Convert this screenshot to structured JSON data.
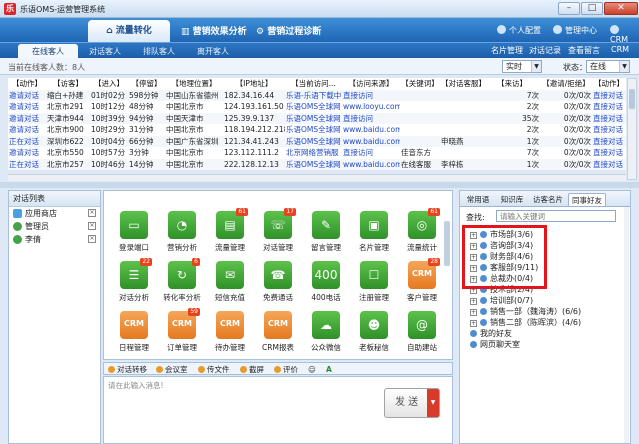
{
  "window": {
    "title": "乐语OMS-运营管理系统",
    "min": "–",
    "max": "□",
    "close": "✕"
  },
  "header": {
    "nav": [
      {
        "label": "流量转化"
      },
      {
        "label": "营销效果分析"
      },
      {
        "label": "营销过程诊断"
      }
    ],
    "links": [
      "个人配置",
      "管理中心",
      "CRM"
    ]
  },
  "tabs": [
    {
      "label": "在线客人"
    },
    {
      "label": "对话客人"
    },
    {
      "label": "排队客人"
    },
    {
      "label": "离开客人"
    }
  ],
  "right_links": [
    "名片管理",
    "对话记录",
    "查看留言",
    "CRM"
  ],
  "filter": {
    "label": "当前在线客人数：8人",
    "select1": "实时",
    "status_label": "状态：",
    "status_value": "在线"
  },
  "table": {
    "headers": [
      "【动作】",
      "【访客】",
      "【进入】",
      "【停留】",
      "【地理位置】",
      "【IP地址】",
      "【当前访问...",
      "【访问来源】",
      "【关键词】",
      "【对话客服】",
      "【来访】",
      "【邀请/拒绝】",
      "【动作】"
    ],
    "rows": [
      [
        "邀请对话",
        "缩白+孙建",
        "01时02分",
        "598分钟",
        "中国山东省德州",
        "182.34.16.44",
        "乐语-乐语下载中",
        "直接访问",
        "",
        "",
        "7次",
        "0次/0次",
        "直接对话"
      ],
      [
        "邀请对话",
        "北京市291",
        "10时12分",
        "48分钟",
        "中国北京市",
        "124.193.161.50",
        "乐语OMS全球网",
        "www.looyu.com",
        "",
        "",
        "2次",
        "0次/0次",
        "直接对话"
      ],
      [
        "邀请对话",
        "天津市944",
        "10时39分",
        "94分钟",
        "中国天津市",
        "125.39.9.137",
        "乐语OMS全球网",
        "直接访问",
        "",
        "",
        "35次",
        "0次/0次",
        "直接对话"
      ],
      [
        "邀请对话",
        "北京市900",
        "10时29分",
        "31分钟",
        "中国北京市",
        "118.194.212.218",
        "乐语OMS全球网",
        "www.baidu.com",
        "",
        "",
        "2次",
        "0次/0次",
        "直接对话"
      ],
      [
        "正在对话",
        "深圳市622",
        "10时04分",
        "66分钟",
        "中国广东省深圳",
        "121.34.41.243",
        "乐语OMS全球网",
        "www.baidu.com",
        "",
        "申晓燕",
        "1次",
        "0次/0次",
        "直接对话"
      ],
      [
        "邀请对话",
        "北京市550",
        "10时57分",
        "3分钟",
        "中国北京市",
        "123.112.111.2",
        "北京网络营销服",
        "直接访问",
        "佳音东方",
        "",
        "7次",
        "0次/0次",
        "直接对话"
      ],
      [
        "正在对话",
        "北京市257",
        "10时46分",
        "14分钟",
        "中国北京市",
        "222.128.12.13",
        "乐语OMS全球网",
        "www.baidu.com",
        "在线客服",
        "李梓栋",
        "1次",
        "0次/0次",
        "直接对话"
      ]
    ]
  },
  "left_panel": {
    "title": "对话列表",
    "items": [
      "应用商店",
      "管理员",
      "李倩"
    ]
  },
  "apps": [
    {
      "label": "登录端口",
      "glyph": "▭",
      "badge": ""
    },
    {
      "label": "营销分析",
      "glyph": "◔",
      "badge": ""
    },
    {
      "label": "流量管理",
      "glyph": "▤",
      "badge": "61"
    },
    {
      "label": "对话管理",
      "glyph": "☏",
      "badge": "17"
    },
    {
      "label": "留言管理",
      "glyph": "✎",
      "badge": ""
    },
    {
      "label": "名片管理",
      "glyph": "▣",
      "badge": ""
    },
    {
      "label": "流量统计",
      "glyph": "◎",
      "badge": "61"
    },
    {
      "label": "对话分析",
      "glyph": "☰",
      "badge": "22"
    },
    {
      "label": "转化率分析",
      "glyph": "↻",
      "badge": "6"
    },
    {
      "label": "短信充值",
      "glyph": "✉",
      "badge": ""
    },
    {
      "label": "免费通话",
      "glyph": "☎",
      "badge": ""
    },
    {
      "label": "400电话",
      "glyph": "400",
      "badge": ""
    },
    {
      "label": "注册管理",
      "glyph": "☐",
      "badge": ""
    },
    {
      "label": "客户管理",
      "glyph": "CRM",
      "badge": "28"
    },
    {
      "label": "日程管理",
      "glyph": "CRM",
      "badge": ""
    },
    {
      "label": "订单管理",
      "glyph": "CRM",
      "badge": "59"
    },
    {
      "label": "待办管理",
      "glyph": "CRM",
      "badge": ""
    },
    {
      "label": "CRM报表",
      "glyph": "CRM",
      "badge": ""
    },
    {
      "label": "公众微信",
      "glyph": "☁",
      "badge": ""
    },
    {
      "label": "老板秘信",
      "glyph": "☻",
      "badge": ""
    },
    {
      "label": "自助建站",
      "glyph": "@",
      "badge": ""
    }
  ],
  "chat_toolbar": [
    "对话转移",
    "会议室",
    "传文件",
    "截屏",
    "评价"
  ],
  "chat_placeholder": "请在此输入消息!",
  "send_label": "发 送",
  "right_panel": {
    "tabs": [
      "常用语",
      "知识库",
      "访客名片",
      "同事好友"
    ],
    "search_label": "查找:",
    "search_placeholder": "请输入关键词",
    "depts": [
      "市场部(3/6)",
      "咨询部(3/4)",
      "财务部(4/6)",
      "客服部(9/11)",
      "总裁办(0/4)",
      "技术部(2/4)",
      "培训部(0/7)",
      "销售一部（魏海涛）(6/6)",
      "销售二部（陈晖滨）(4/6)",
      "我的好友",
      "网页聊天室"
    ]
  },
  "colors": {
    "accent": "#1f65b5",
    "highlight": "#e3141b",
    "tile": "#2f9129",
    "crm": "#e57a1f"
  }
}
